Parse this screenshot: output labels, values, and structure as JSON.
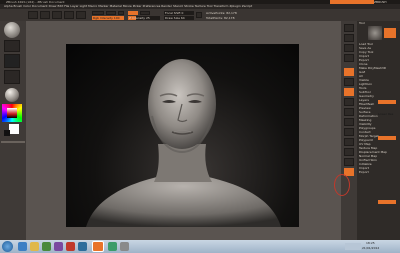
{
  "app": {
    "title": "ZBrush 4R2b (x64) - ZBrush Document",
    "logo_text": "ZBRUSH"
  },
  "menu": {
    "items": [
      "Alpha",
      "Brush",
      "Color",
      "Document",
      "Draw",
      "Edit",
      "File",
      "Layer",
      "Light",
      "Macro",
      "Marker",
      "Material",
      "Movie",
      "Picker",
      "Preferences",
      "Render",
      "Stencil",
      "Stroke",
      "Texture",
      "Tool",
      "Transform",
      "Zplugin",
      "Zscript"
    ]
  },
  "toolbar": {
    "buttons": [
      "Edit",
      "Draw",
      "Move",
      "Scale",
      "Rotate"
    ],
    "mrgb_label": "Mrgb",
    "rgb_label": "Rgb",
    "m_label": "M",
    "zadd_label": "Zadd",
    "zsub_label": "Zsub",
    "focal_label": "Focal Shift 0",
    "draw_size_label": "Draw Size 64",
    "rgb_intensity": "Rgb Intensity 100",
    "z_intensity": "Z Intensity 25",
    "active_points": "ActivePoints: 82,178",
    "total_points": "TotalPoints: 82,178"
  },
  "right_panel": {
    "header": "Tool",
    "items": [
      "Load Tool",
      "Save As",
      "Copy Tool",
      "Import",
      "Export",
      "Clone",
      "Make PolyMesh3D",
      "GoZ",
      "All",
      "Visible",
      "Lightbox",
      "Tools",
      "SubTool",
      "Geometry",
      "Layers",
      "FiberMesh",
      "Preview",
      "Surface",
      "Deformation",
      "Masking",
      "Visibility",
      "Polygroups",
      "Contact",
      "Morph Target",
      "Polypaint",
      "UV Map",
      "Texture Map",
      "Displacement Map",
      "Normal Map",
      "Unified Skin",
      "Initialize",
      "Import",
      "Export"
    ],
    "highlight_label": "Lower Res"
  },
  "taskbar": {
    "time": "18:25",
    "date": "21/01/2012"
  },
  "colors": {
    "accent": "#e8732a",
    "background": "#4a4541",
    "panel": "#3a3532",
    "canvas": "#050505"
  }
}
